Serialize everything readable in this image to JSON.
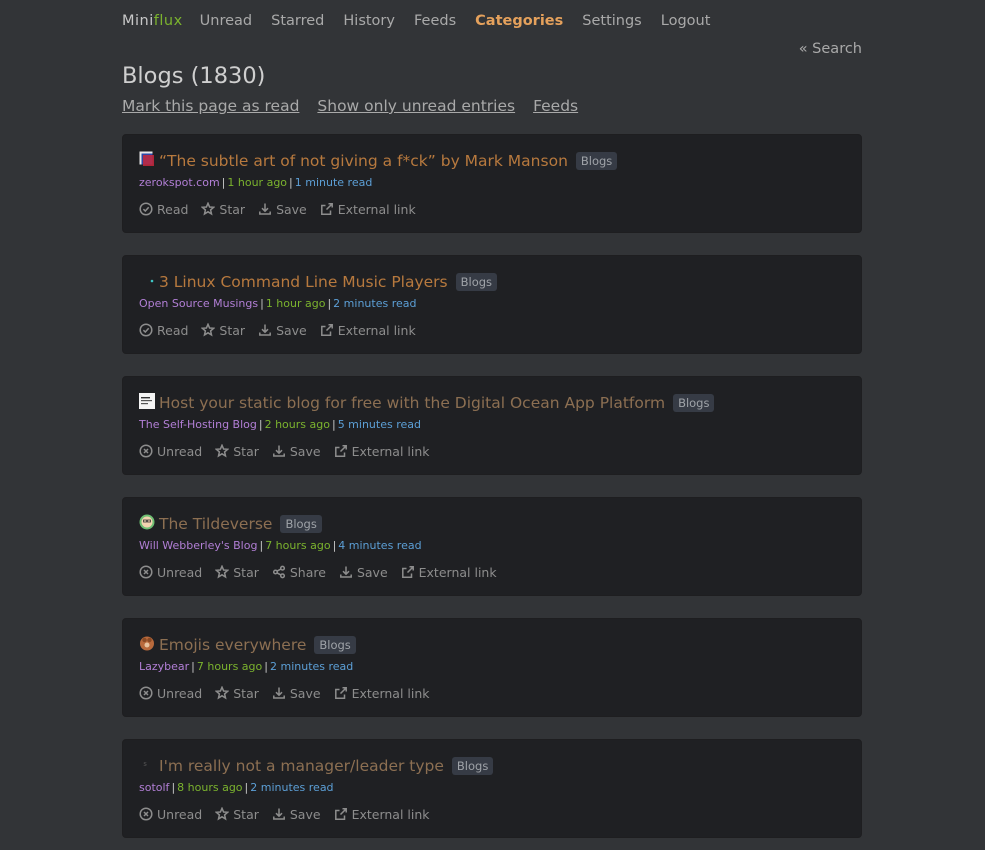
{
  "app": {
    "logo_part1": "Mini",
    "logo_part2": "flux"
  },
  "nav": {
    "items": [
      {
        "label": "Unread",
        "active": false
      },
      {
        "label": "Starred",
        "active": false
      },
      {
        "label": "History",
        "active": false
      },
      {
        "label": "Feeds",
        "active": false
      },
      {
        "label": "Categories",
        "active": true
      },
      {
        "label": "Settings",
        "active": false
      },
      {
        "label": "Logout",
        "active": false
      }
    ],
    "search_label": "« Search"
  },
  "page": {
    "title": "Blogs (1830)",
    "links": [
      "Mark this page as read",
      "Show only unread entries",
      "Feeds"
    ]
  },
  "entries": [
    {
      "title": "“The subtle art of not giving a f*ck” by Mark Manson",
      "category": "Blogs",
      "feed": "zerokspot.com",
      "time": "1 hour ago",
      "reading_time": "1 minute read",
      "status": "read",
      "actions": [
        {
          "label": "Read",
          "icon": "check-circle-icon"
        },
        {
          "label": "Star",
          "icon": "star-icon"
        },
        {
          "label": "Save",
          "icon": "download-icon"
        },
        {
          "label": "External link",
          "icon": "external-link-icon"
        }
      ]
    },
    {
      "title": "3 Linux Command Line Music Players",
      "category": "Blogs",
      "feed": "Open Source Musings",
      "time": "1 hour ago",
      "reading_time": "2 minutes read",
      "status": "read",
      "actions": [
        {
          "label": "Read",
          "icon": "check-circle-icon"
        },
        {
          "label": "Star",
          "icon": "star-icon"
        },
        {
          "label": "Save",
          "icon": "download-icon"
        },
        {
          "label": "External link",
          "icon": "external-link-icon"
        }
      ]
    },
    {
      "title": "Host your static blog for free with the Digital Ocean App Platform",
      "category": "Blogs",
      "feed": "The Self-Hosting Blog",
      "time": "2 hours ago",
      "reading_time": "5 minutes read",
      "status": "dim",
      "actions": [
        {
          "label": "Unread",
          "icon": "x-circle-icon"
        },
        {
          "label": "Star",
          "icon": "star-icon"
        },
        {
          "label": "Save",
          "icon": "download-icon"
        },
        {
          "label": "External link",
          "icon": "external-link-icon"
        }
      ]
    },
    {
      "title": "The Tildeverse",
      "category": "Blogs",
      "feed": "Will Webberley's Blog",
      "time": "7 hours ago",
      "reading_time": "4 minutes read",
      "status": "dim",
      "actions": [
        {
          "label": "Unread",
          "icon": "x-circle-icon"
        },
        {
          "label": "Star",
          "icon": "star-icon"
        },
        {
          "label": "Share",
          "icon": "share-icon"
        },
        {
          "label": "Save",
          "icon": "download-icon"
        },
        {
          "label": "External link",
          "icon": "external-link-icon"
        }
      ]
    },
    {
      "title": "Emojis everywhere",
      "category": "Blogs",
      "feed": "Lazybear",
      "time": "7 hours ago",
      "reading_time": "2 minutes read",
      "status": "dim",
      "actions": [
        {
          "label": "Unread",
          "icon": "x-circle-icon"
        },
        {
          "label": "Star",
          "icon": "star-icon"
        },
        {
          "label": "Save",
          "icon": "download-icon"
        },
        {
          "label": "External link",
          "icon": "external-link-icon"
        }
      ]
    },
    {
      "title": "I'm really not a manager/leader type",
      "category": "Blogs",
      "feed": "sotolf",
      "time": "8 hours ago",
      "reading_time": "2 minutes read",
      "status": "dim",
      "actions": [
        {
          "label": "Unread",
          "icon": "x-circle-icon"
        },
        {
          "label": "Star",
          "icon": "star-icon"
        },
        {
          "label": "Save",
          "icon": "download-icon"
        },
        {
          "label": "External link",
          "icon": "external-link-icon"
        }
      ]
    }
  ]
}
